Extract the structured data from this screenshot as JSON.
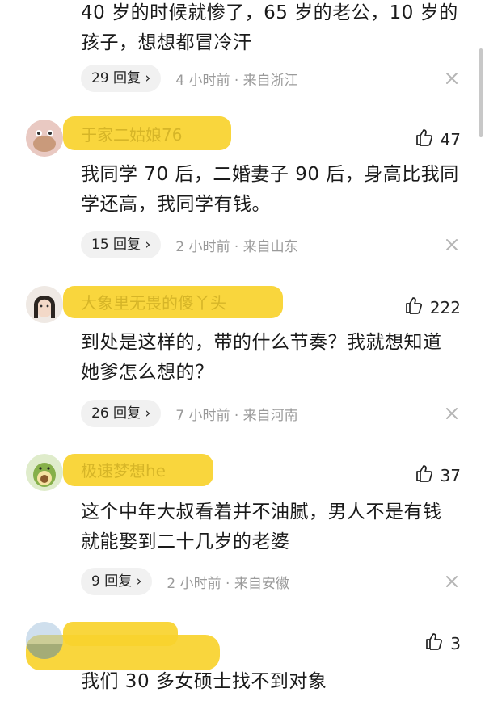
{
  "comments": [
    {
      "username": "",
      "likes": "",
      "text_lines": [
        "40 岁的时候就惨了，65 岁的老公，10 岁的",
        "孩子，想想都冒冷汗"
      ],
      "reply_label": "29 回复 ›",
      "meta": "4 小时前 · 来自浙江"
    },
    {
      "username": "于家二姑娘76",
      "likes": "47",
      "text_lines": [
        "我同学 70 后，二婚妻子 90 后，身高比我同",
        "学还高，我同学有钱。"
      ],
      "reply_label": "15 回复 ›",
      "meta": "2 小时前 · 来自山东"
    },
    {
      "username": "大象里无畏的傻丫头",
      "likes": "222",
      "text_lines": [
        "到处是这样的，带的什么节奏？我就想知道",
        "她爹怎么想的？"
      ],
      "reply_label": "26 回复 ›",
      "meta": "7 小时前 · 来自河南"
    },
    {
      "username": "极速梦想he",
      "likes": "37",
      "text_lines": [
        "这个中年大叔看着并不油腻，男人不是有钱",
        "就能娶到二十几岁的老婆"
      ],
      "reply_label": "9 回复 ›",
      "meta": "2 小时前 · 来自安徽"
    },
    {
      "username": "",
      "likes": "3",
      "text_lines": [
        "我们 30 多女硕士找不到对象"
      ],
      "reply_label": "",
      "meta": ""
    }
  ],
  "colors": {
    "highlight": "#f8d22c",
    "meta_text": "#9a9a9a",
    "pill_bg": "#f1f1f1"
  },
  "icons": {
    "like": "thumbs-up-icon",
    "close": "close-icon"
  }
}
